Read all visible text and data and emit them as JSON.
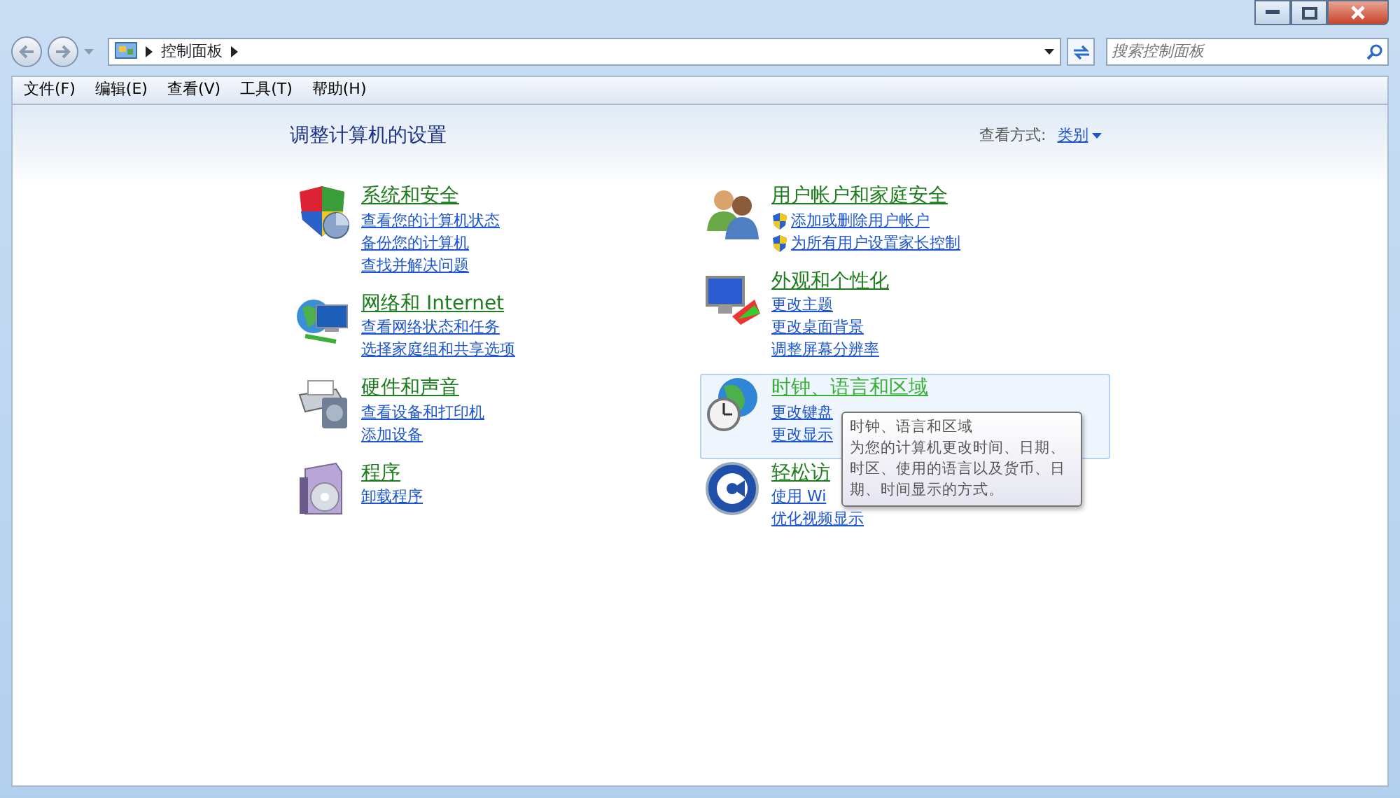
{
  "address_bar": {
    "crumbs": [
      "控制面板"
    ]
  },
  "search": {
    "placeholder": "搜索控制面板"
  },
  "menu": [
    "文件(F)",
    "编辑(E)",
    "查看(V)",
    "工具(T)",
    "帮助(H)"
  ],
  "heading": "调整计算机的设置",
  "view_by": {
    "label": "查看方式:",
    "value": "类别"
  },
  "columns": [
    [
      {
        "kind": "security",
        "title": "系统和安全",
        "hovered": false,
        "links": [
          {
            "text": "查看您的计算机状态",
            "shield": false
          },
          {
            "text": "备份您的计算机",
            "shield": false
          },
          {
            "text": "查找并解决问题",
            "shield": false
          }
        ]
      },
      {
        "kind": "network",
        "title": "网络和 Internet",
        "hovered": false,
        "links": [
          {
            "text": "查看网络状态和任务",
            "shield": false
          },
          {
            "text": "选择家庭组和共享选项",
            "shield": false
          }
        ]
      },
      {
        "kind": "hardware",
        "title": "硬件和声音",
        "hovered": false,
        "links": [
          {
            "text": "查看设备和打印机",
            "shield": false
          },
          {
            "text": "添加设备",
            "shield": false
          }
        ]
      },
      {
        "kind": "programs",
        "title": "程序",
        "hovered": false,
        "links": [
          {
            "text": "卸载程序",
            "shield": false
          }
        ]
      }
    ],
    [
      {
        "kind": "users",
        "title": "用户帐户和家庭安全",
        "hovered": false,
        "links": [
          {
            "text": "添加或删除用户帐户",
            "shield": true
          },
          {
            "text": "为所有用户设置家长控制",
            "shield": true
          }
        ]
      },
      {
        "kind": "appearance",
        "title": "外观和个性化",
        "hovered": false,
        "links": [
          {
            "text": "更改主题",
            "shield": false
          },
          {
            "text": "更改桌面背景",
            "shield": false
          },
          {
            "text": "调整屏幕分辨率",
            "shield": false
          }
        ]
      },
      {
        "kind": "clock",
        "title": "时钟、语言和区域",
        "hovered": true,
        "links": [
          {
            "text": "更改键盘",
            "shield": false
          },
          {
            "text": "更改显示",
            "shield": false
          }
        ],
        "tooltip": {
          "title": "时钟、语言和区域",
          "text": "为您的计算机更改时间、日期、时区、使用的语言以及货币、日期、时间显示的方式。"
        }
      },
      {
        "kind": "access",
        "title": "轻松访",
        "hovered": false,
        "links": [
          {
            "text": "使用 Wi",
            "shield": false
          },
          {
            "text": "优化视频显示",
            "shield": false
          }
        ]
      }
    ]
  ]
}
